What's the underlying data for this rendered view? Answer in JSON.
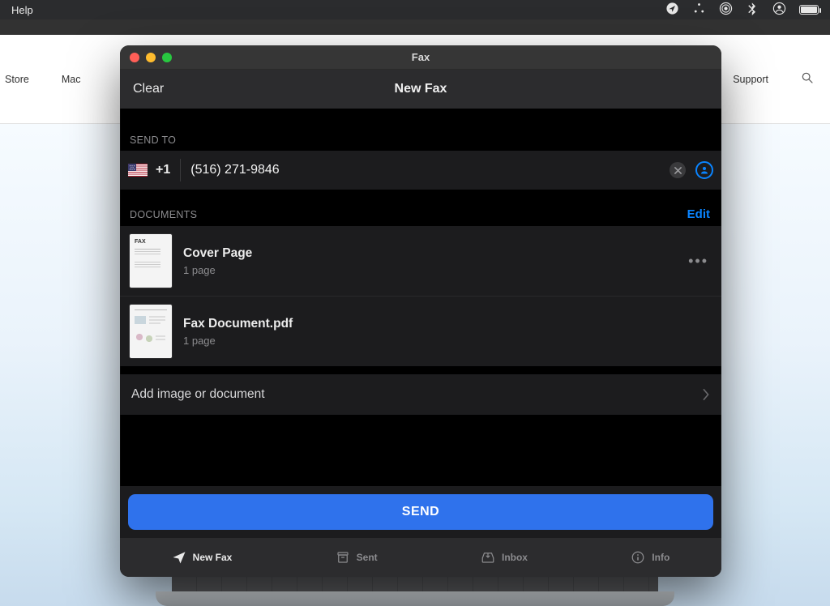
{
  "menubar": {
    "help": "Help"
  },
  "apple_nav": {
    "store": "Store",
    "mac": "Mac",
    "support": "Support"
  },
  "fax": {
    "window_title": "Fax",
    "clear": "Clear",
    "page_title": "New Fax",
    "send_to_label": "SEND TO",
    "country_code": "+1",
    "phone_number": "(516) 271-9846",
    "documents_label": "DOCUMENTS",
    "edit": "Edit",
    "documents": [
      {
        "title": "Cover Page",
        "subtitle": "1 page"
      },
      {
        "title": "Fax Document.pdf",
        "subtitle": "1 page"
      }
    ],
    "add_document": "Add image or document",
    "send": "SEND",
    "tabs": {
      "new_fax": "New Fax",
      "sent": "Sent",
      "inbox": "Inbox",
      "info": "Info"
    }
  }
}
